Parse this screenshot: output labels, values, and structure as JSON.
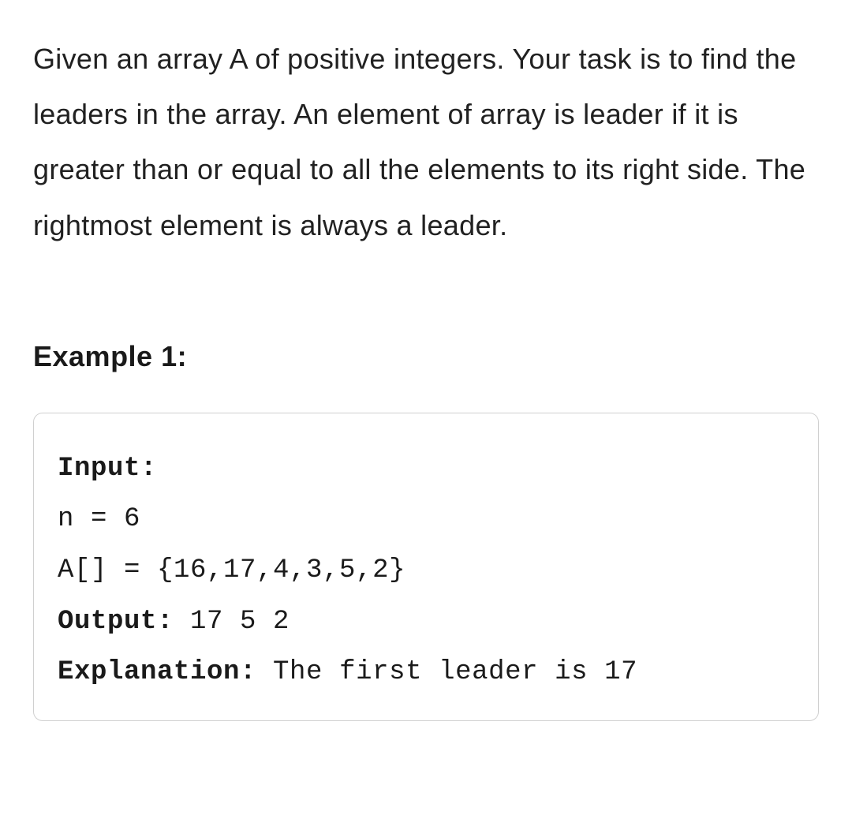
{
  "problem": {
    "description": "Given an array A of positive integers. Your task is to find the leaders in the array. An element of array is leader if it is greater than or equal to all the elements to its right side. The rightmost element is always a leader."
  },
  "example": {
    "heading": "Example 1:",
    "input_label": "Input:",
    "input_n": "n = 6",
    "input_array": "A[] = {16,17,4,3,5,2}",
    "output_label": "Output:",
    "output_value": " 17 5 2",
    "explanation_label": "Explanation:",
    "explanation_value": " The first leader is 17"
  }
}
